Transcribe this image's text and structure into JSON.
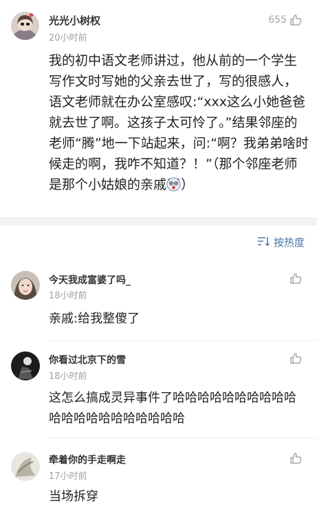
{
  "post": {
    "username": "光光小树权",
    "time": "20小时前",
    "likes": "655",
    "text_before_emoji": "我的初中语文老师讲过，他从前的一个学生写作文时写她的父亲去世了，写的很感人，语文老师就在办公室感叹:“xxx这么小她爸爸就去世了啊。这孩子太可怜了。”结果邻座的老师“腾”地一下站起来，问:“啊？我弟弟啥时候走的啊，我咋不知道？！”（那个邻座老师是那个小姑娘的亲戚",
    "text_after_emoji": "）",
    "emoji": "shocked-face-emoji"
  },
  "sort": {
    "label": "按热度",
    "icon": "sort-icon"
  },
  "comments": [
    {
      "username": "今天我成富婆了吗_",
      "time": "18小时前",
      "text": "亲戚:给我整傻了"
    },
    {
      "username": "你看过北京下的雪",
      "time": "18小时前",
      "text": "这怎么搞成灵异事件了哈哈哈哈哈哈哈哈哈哈哈哈哈哈哈哈哈哈哈哈哈"
    },
    {
      "username": "牵着你的手走啊走",
      "time": "17小时前",
      "text": "当场拆穿"
    }
  ],
  "colors": {
    "accent": "#4a76a8",
    "meta": "#a0a0a0",
    "separator": "#f3f3f3"
  }
}
